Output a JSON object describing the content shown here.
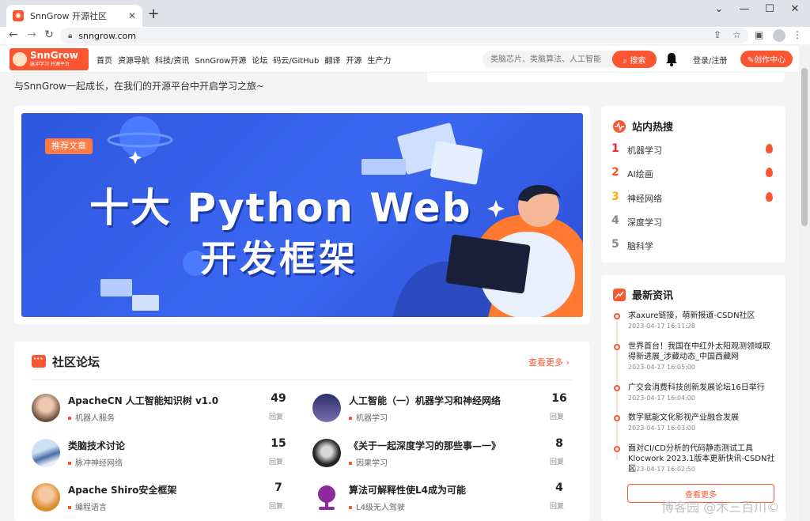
{
  "browser": {
    "tab_title": "SnnGrow 开源社区",
    "tab_close": "✕",
    "new_tab": "+",
    "url": "snngrow.com",
    "win_min": "⌄",
    "win_minimize": "—",
    "win_max": "☐",
    "win_close": "✕"
  },
  "header": {
    "logo_name": "SnnGrow",
    "logo_slogan": "脉冲学习 开源平台",
    "nav": [
      "首页",
      "资源导航",
      "科技/资讯",
      "SnnGrow开源",
      "论坛",
      "码云/GitHub",
      "翻译",
      "开源",
      "生产力"
    ],
    "search_placeholder": "类脑芯片、类脑算法、人工智能",
    "search_button": "⌕ 搜索",
    "login": "登录/注册",
    "create": "✎创作中心"
  },
  "welcome": "与SnnGrow一起成长，在我们的开源平台中开启学习之旅~",
  "banner": {
    "tag": "推荐文章",
    "title_line1": "十大 Python Web",
    "title_line2": "开发框架"
  },
  "forum": {
    "title": "社区论坛",
    "more": "查看更多 ›",
    "posts": [
      {
        "title": "ApacheCN 人工智能知识树 v1.0",
        "category": "机器人服务",
        "count": "49",
        "reply": "回复"
      },
      {
        "title": "人工智能（一）机器学习和神经网络",
        "category": "机器学习",
        "count": "16",
        "reply": "回复"
      },
      {
        "title": "类脑技术讨论",
        "category": "脉冲神经网络",
        "count": "15",
        "reply": "回复"
      },
      {
        "title": "《关于一起深度学习的那些事—一》",
        "category": "因果学习",
        "count": "8",
        "reply": "回复"
      },
      {
        "title": "Apache Shiro安全框架",
        "category": "编程语言",
        "count": "7",
        "reply": "回复"
      },
      {
        "title": "算法可解释性使L4成为可能",
        "category": "L4级无人驾驶",
        "count": "4",
        "reply": "回复"
      }
    ]
  },
  "hot": {
    "title": "站内热搜",
    "items": [
      {
        "rank": "1",
        "label": "机器学习",
        "color": "#f5222d"
      },
      {
        "rank": "2",
        "label": "AI绘画",
        "color": "#fa541c"
      },
      {
        "rank": "3",
        "label": "神经网络",
        "color": "#faad14"
      },
      {
        "rank": "4",
        "label": "深度学习",
        "color": "#888888"
      },
      {
        "rank": "5",
        "label": "脑科学",
        "color": "#888888"
      }
    ]
  },
  "news": {
    "title": "最新资讯",
    "items": [
      {
        "title": "求axure链接，萌新报道-CSDN社区",
        "date": "2023-04-17 16:11:28"
      },
      {
        "title": "世界首台！我国在中红外太阳观测领域取得新进展_涉藏动态_中国西藏网",
        "date": "2023-04-17 16:05:00"
      },
      {
        "title": "广交会消费科技创新发展论坛16日举行",
        "date": "2023-04-17 16:04:00"
      },
      {
        "title": "数字赋能文化影视产业融合发展",
        "date": "2023-04-17 16:03:00"
      },
      {
        "title": "面对CI/CD分析的代码静态测试工具Klocwork 2023.1版本更新快讯-CSDN社区",
        "date": "2023-04-17 16:02:50"
      }
    ],
    "more": "查看更多"
  },
  "watermark": "博客园 @木三百川©",
  "colors": {
    "accent": "#fc5531",
    "banner": "#3b67f0"
  }
}
